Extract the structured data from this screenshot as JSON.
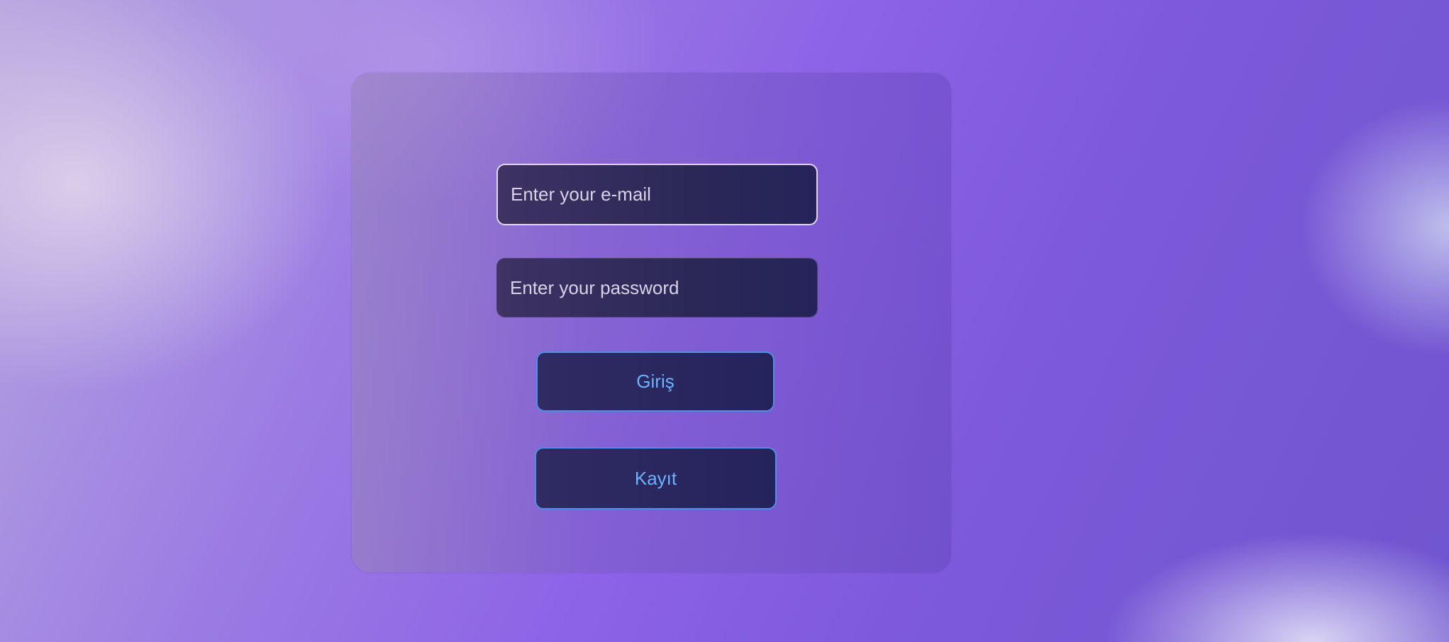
{
  "login_form": {
    "email_placeholder": "Enter your e-mail",
    "password_placeholder": "Enter your password",
    "login_button_label": "Giriş",
    "register_button_label": "Kayıt"
  },
  "colors": {
    "background_accent": "#8c62e6",
    "field_background": "#2b2857",
    "button_border": "#4f8fe4",
    "button_text": "#6ab3ff"
  }
}
